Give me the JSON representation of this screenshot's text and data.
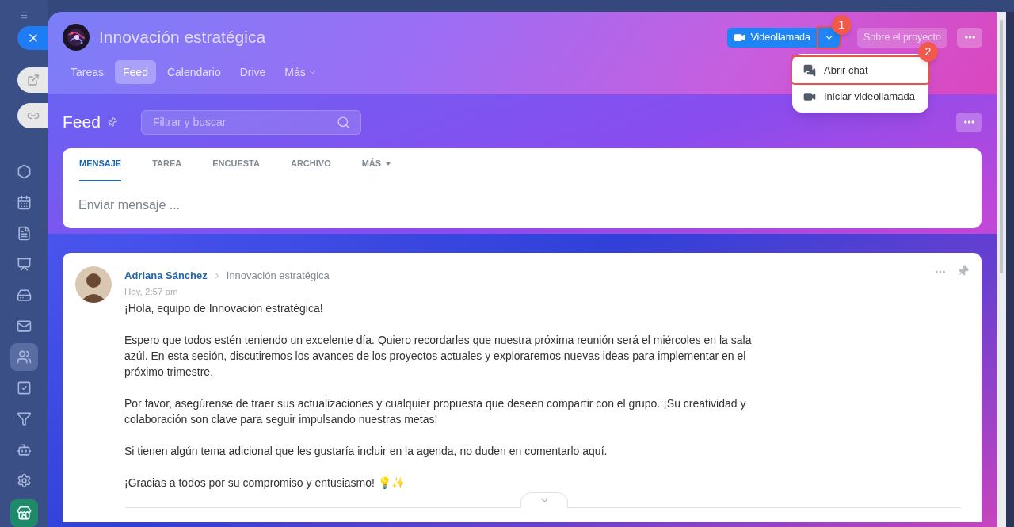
{
  "sidebar": {
    "items": [
      {
        "kind": "hexagon",
        "selected": false
      },
      {
        "kind": "calendar",
        "selected": false
      },
      {
        "kind": "document",
        "selected": false
      },
      {
        "kind": "presentation",
        "selected": false
      },
      {
        "kind": "drive",
        "selected": false
      },
      {
        "kind": "mail",
        "selected": false
      },
      {
        "kind": "people",
        "selected": true
      },
      {
        "kind": "task",
        "selected": false
      },
      {
        "kind": "funnel",
        "selected": false
      },
      {
        "kind": "robot",
        "selected": false
      },
      {
        "kind": "settings",
        "selected": false
      },
      {
        "kind": "app",
        "selected": false
      }
    ]
  },
  "project": {
    "title": "Innovación estratégica",
    "tabs": [
      {
        "label": "Tareas",
        "selected": false
      },
      {
        "label": "Feed",
        "selected": true
      },
      {
        "label": "Calendario",
        "selected": false
      },
      {
        "label": "Drive",
        "selected": false
      },
      {
        "label": "Más",
        "selected": false
      }
    ],
    "video_button": "Videollamada",
    "about_button": "Sobre el proyecto",
    "dropdown": [
      {
        "kind": "chat",
        "label": "Abrir chat",
        "highlighted": true
      },
      {
        "kind": "video",
        "label": "Iniciar videollamada",
        "highlighted": false
      }
    ],
    "callouts": [
      "1",
      "2"
    ]
  },
  "feed": {
    "title": "Feed",
    "search": {
      "placeholder": "Filtrar y buscar"
    },
    "composer": {
      "tabs": [
        {
          "label": "MENSAJE",
          "selected": true
        },
        {
          "label": "TAREA",
          "selected": false
        },
        {
          "label": "ENCUESTA",
          "selected": false
        },
        {
          "label": "ARCHIVO",
          "selected": false
        },
        {
          "label": "MÁS",
          "selected": false
        }
      ],
      "placeholder": "Enviar mensaje ..."
    },
    "post": {
      "author": "Adriana Sánchez",
      "destination": "Innovación estratégica",
      "time": "Hoy, 2:57 pm",
      "paragraphs": [
        "¡Hola, equipo de Innovación estratégica!",
        "Espero que todos estén teniendo un excelente día. Quiero recordarles que nuestra próxima reunión será el miércoles en la sala azúl. En esta sesión, discutiremos los avances de los proyectos actuales y exploraremos nuevas ideas para implementar en el próximo trimestre.",
        "Por favor, asegúrense de traer sus actualizaciones y cualquier propuesta que deseen compartir con el grupo. ¡Su creatividad y colaboración son clave para seguir impulsando nuestras metas!",
        "Si tienen algún tema adicional que les gustaría incluir en la agenda, no duden en comentarlo aquí.",
        "¡Gracias a todos por su compromiso y entusiasmo! 💡✨"
      ]
    }
  }
}
